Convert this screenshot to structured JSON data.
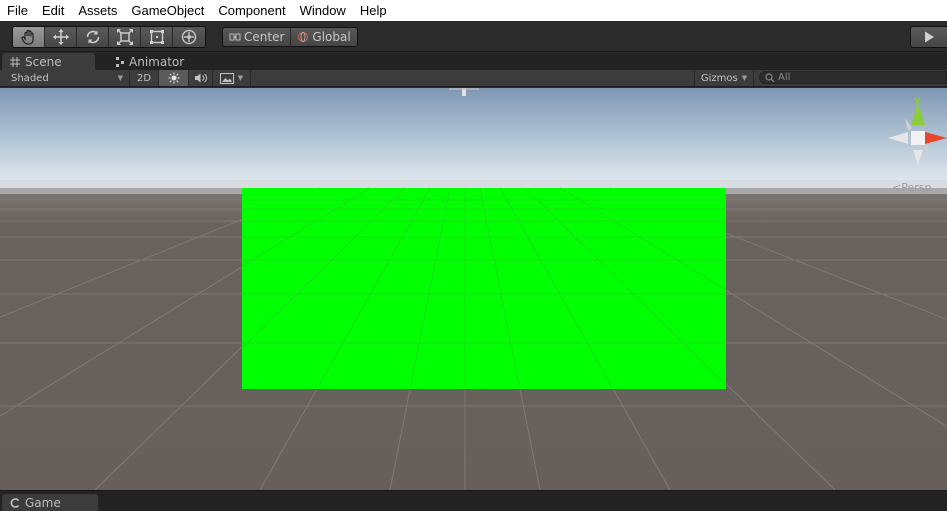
{
  "menu": {
    "items": [
      {
        "label": "File"
      },
      {
        "label": "Edit"
      },
      {
        "label": "Assets"
      },
      {
        "label": "GameObject"
      },
      {
        "label": "Component"
      },
      {
        "label": "Window"
      },
      {
        "label": "Help"
      }
    ]
  },
  "toolbar": {
    "tools": [
      {
        "icon": "hand-icon",
        "active": true
      },
      {
        "icon": "move-icon",
        "active": false
      },
      {
        "icon": "rotate-icon",
        "active": false
      },
      {
        "icon": "scale-icon",
        "active": false
      },
      {
        "icon": "rect-tool-icon",
        "active": false
      },
      {
        "icon": "transform-tool-icon",
        "active": false
      }
    ],
    "pivot_label": "Center",
    "space_label": "Global"
  },
  "tabs": {
    "scene_label": "Scene",
    "animator_label": "Animator",
    "game_label": "Game"
  },
  "scene_toolbar": {
    "draw_mode": "Shaded",
    "mode_2d_label": "2D",
    "gizmos_label": "Gizmos",
    "search_placeholder": "All"
  },
  "scene": {
    "persp_label": "Persp",
    "axis_y_label": "y",
    "sky_color": "#9fb4c8",
    "ground_color": "#6a625d",
    "plane_color": "#00ff00",
    "axis_x_color": "#e8452c",
    "axis_y_color": "#8ccc3c"
  }
}
